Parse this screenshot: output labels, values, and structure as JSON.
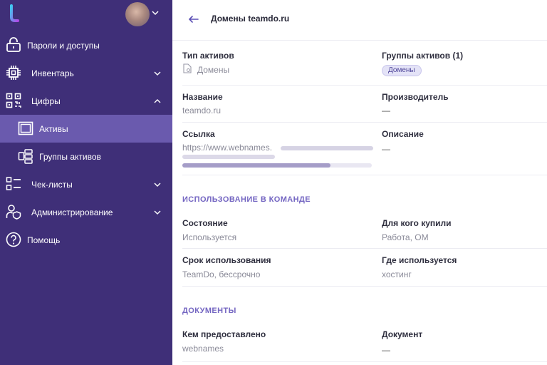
{
  "colors": {
    "sidebar_bg": "#3f2f78",
    "active_bg": "#6a5aae",
    "accent": "#7466c2"
  },
  "sidebar": {
    "items": [
      {
        "label": "Пароли и доступы",
        "icon": "lock-icon"
      },
      {
        "label": "Инвентарь",
        "icon": "chip-icon",
        "expandable": true,
        "expanded": false
      },
      {
        "label": "Цифры",
        "icon": "qr-code-icon",
        "expandable": true,
        "expanded": true
      },
      {
        "label": "Активы",
        "icon": "window-icon",
        "active": true
      },
      {
        "label": "Группы активов",
        "icon": "asset-groups-icon"
      },
      {
        "label": "Чек-листы",
        "icon": "checklist-icon",
        "expandable": true,
        "expanded": false
      },
      {
        "label": "Администрирование",
        "icon": "admin-user-icon",
        "expandable": true,
        "expanded": false
      },
      {
        "label": "Помощь",
        "icon": "help-icon"
      }
    ]
  },
  "header": {
    "title": "Домены teamdo.ru"
  },
  "details": {
    "asset_type_label": "Тип активов",
    "asset_type_value": "Домены",
    "asset_groups_label": "Группы активов (1)",
    "asset_groups_badge": "Домены",
    "name_label": "Название",
    "name_value": "teamdo.ru",
    "manufacturer_label": "Производитель",
    "manufacturer_value": "—",
    "link_label": "Ссылка",
    "link_value": "https://www.webnames.",
    "description_label": "Описание",
    "description_value": "—"
  },
  "usage": {
    "section_title": "ИСПОЛЬЗОВАНИЕ В КОМАНДЕ",
    "state_label": "Состояние",
    "state_value": "Используется",
    "for_whom_label": "Для кого купили",
    "for_whom_value": "Работа, ОМ",
    "term_label": "Срок использования",
    "term_value": "TeamDo, бессрочно",
    "where_label": "Где используется",
    "where_value": "хостинг"
  },
  "documents": {
    "section_title": "ДОКУМЕНТЫ",
    "provided_by_label": "Кем предоставлено",
    "provided_by_value": "webnames",
    "document_label": "Документ",
    "document_value": "—"
  }
}
